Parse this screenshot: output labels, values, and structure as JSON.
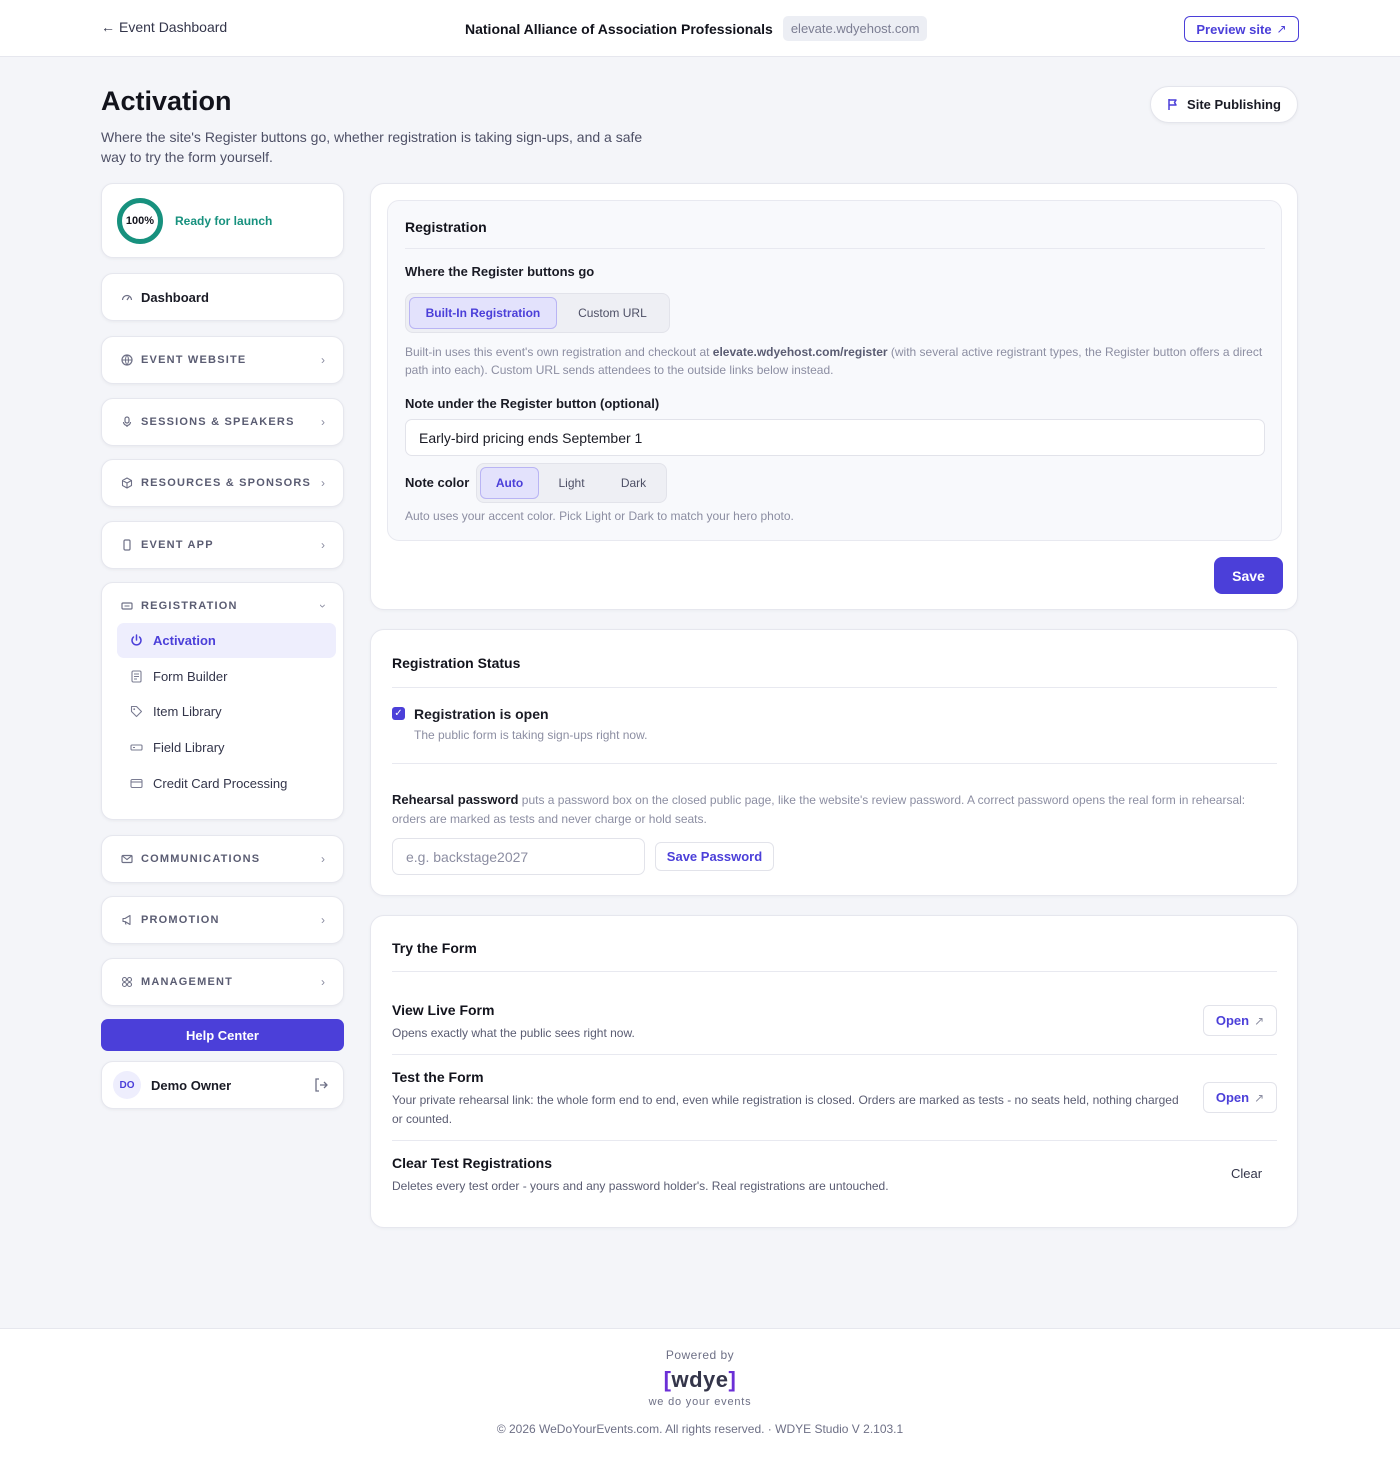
{
  "topbar": {
    "back_label": "Event Dashboard",
    "org_name": "National Alliance of Association Professionals",
    "org_domain": "elevate.wdyehost.com",
    "preview_label": "Preview site"
  },
  "header": {
    "title": "Activation",
    "subtitle": "Where the site's Register buttons go, whether registration is taking sign-ups, and a safe way to try the form yourself.",
    "publish_label": "Site Publishing"
  },
  "sidebar": {
    "progress_value": "100%",
    "progress_fraction": 1.0,
    "progress_status": "Ready for launch",
    "dashboard_label": "Dashboard",
    "nav_items": [
      {
        "label": "EVENT WEBSITE",
        "icon": "globe-icon"
      },
      {
        "label": "SESSIONS & SPEAKERS",
        "icon": "microphone-icon"
      },
      {
        "label": "RESOURCES & SPONSORS",
        "icon": "box-icon"
      },
      {
        "label": "EVENT APP",
        "icon": "phone-icon"
      },
      {
        "label": "REGISTRATION",
        "icon": "ticket-icon"
      },
      {
        "label": "COMMUNICATIONS",
        "icon": "mail-icon"
      },
      {
        "label": "PROMOTION",
        "icon": "megaphone-icon"
      },
      {
        "label": "MANAGEMENT",
        "icon": "grid-icon"
      }
    ],
    "registration_items": [
      {
        "label": "Activation",
        "icon": "power-icon",
        "active": true
      },
      {
        "label": "Form Builder",
        "icon": "document-icon"
      },
      {
        "label": "Item Library",
        "icon": "tag-icon"
      },
      {
        "label": "Field Library",
        "icon": "field-icon"
      },
      {
        "label": "Credit Card Processing",
        "icon": "credit-card-icon"
      }
    ],
    "help_label": "Help Center",
    "user": {
      "initials": "DO",
      "name": "Demo Owner"
    }
  },
  "registration": {
    "title": "Registration",
    "buttons_heading": "Where the Register buttons go",
    "mode_options": [
      "Built-In Registration",
      "Custom URL"
    ],
    "mode_selected": "Built-In Registration",
    "mode_help_pre": "Built-in uses this event's own registration and checkout at ",
    "mode_help_link": "elevate.wdyehost.com/register",
    "mode_help_post": " (with several active registrant types, the Register button offers a direct path into each). Custom URL sends attendees to the outside links below instead.",
    "note_label": "Note under the Register button (optional)",
    "note_value": "Early-bird pricing ends September 1",
    "color_label": "Note color",
    "color_options": [
      "Auto",
      "Light",
      "Dark"
    ],
    "color_selected": "Auto",
    "color_help": "Auto uses your accent color. Pick Light or Dark to match your hero photo.",
    "save_label": "Save"
  },
  "status": {
    "title": "Registration Status",
    "open_label": "Registration is open",
    "open_checked": true,
    "open_help": "The public form is taking sign-ups right now.",
    "password_label": "Rehearsal password",
    "password_help": " puts a password box on the closed public page, like the website's review password. A correct password opens the real form in rehearsal: orders are marked as tests and never charge or hold seats.",
    "password_placeholder": "e.g. backstage2027",
    "save_password_label": "Save Password"
  },
  "try_form": {
    "title": "Try the Form",
    "rows": [
      {
        "title": "View Live Form",
        "desc": "Opens exactly what the public sees right now.",
        "action": "Open"
      },
      {
        "title": "Test the Form",
        "desc": "Your private rehearsal link: the whole form end to end, even while registration is closed. Orders are marked as tests - no seats held, nothing charged or counted.",
        "action": "Open"
      },
      {
        "title": "Clear Test Registrations",
        "desc": "Deletes every test order - yours and any password holder's. Real registrations are untouched.",
        "action": "Clear"
      }
    ]
  },
  "footer": {
    "powered": "Powered by",
    "logo_open": "[",
    "logo_text": "wdye",
    "logo_close": "]",
    "tagline": "we do your events",
    "copyright": "© 2026 WeDoYourEvents.com. All rights reserved. · WDYE Studio V 2.103.1"
  },
  "colors": {
    "accent": "#4b3fd9",
    "success": "#17917e",
    "background": "#f4f5f9"
  }
}
